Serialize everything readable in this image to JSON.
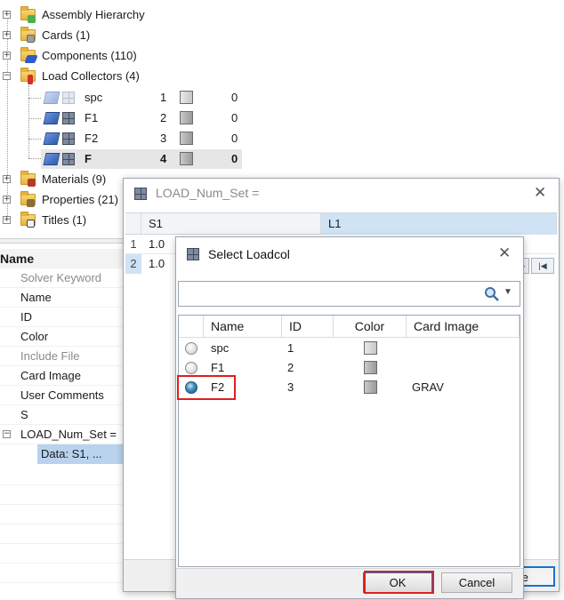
{
  "tree": {
    "nodes": [
      {
        "label": "Assembly Hierarchy",
        "expander": "+"
      },
      {
        "label": "Cards (1)",
        "expander": "+"
      },
      {
        "label": "Components (110)",
        "expander": "+"
      },
      {
        "label": "Load Collectors (4)",
        "expander": "−"
      },
      {
        "label": "Materials (9)",
        "expander": "+"
      },
      {
        "label": "Properties (21)",
        "expander": "+"
      },
      {
        "label": "Titles (1)",
        "expander": "+"
      }
    ],
    "load_collectors": [
      {
        "name": "spc",
        "id": "1",
        "value": "0"
      },
      {
        "name": "F1",
        "id": "2",
        "value": "0"
      },
      {
        "name": "F2",
        "id": "3",
        "value": "0"
      },
      {
        "name": "F",
        "id": "4",
        "value": "0"
      }
    ]
  },
  "properties": {
    "header": "Name",
    "rows": [
      {
        "label": "Solver Keyword",
        "disabled": true
      },
      {
        "label": "Name"
      },
      {
        "label": "ID"
      },
      {
        "label": "Color"
      },
      {
        "label": "Include File",
        "disabled": true
      },
      {
        "label": "Card Image"
      },
      {
        "label": "User Comments"
      },
      {
        "label": "S"
      },
      {
        "label": "LOAD_Num_Set ="
      }
    ],
    "subvalue": "Data: S1, ..."
  },
  "load_dialog": {
    "title": "LOAD_Num_Set =",
    "columns": [
      "S1",
      "L1"
    ],
    "rows": [
      {
        "index": "1",
        "s1": "1.0"
      },
      {
        "index": "2",
        "s1": "1.0"
      }
    ],
    "close_partial": "e"
  },
  "select_dialog": {
    "title": "Select Loadcol",
    "search_value": "",
    "columns": [
      "Name",
      "ID",
      "Color",
      "Card Image"
    ],
    "rows": [
      {
        "name": "spc",
        "id": "1",
        "card_image": "",
        "selected": false
      },
      {
        "name": "F1",
        "id": "2",
        "card_image": "",
        "selected": false
      },
      {
        "name": "F2",
        "id": "3",
        "card_image": "GRAV",
        "selected": true
      }
    ],
    "ok_label": "OK",
    "cancel_label": "Cancel"
  },
  "colors": {
    "selection_bg": "#e6e6e6",
    "subvalue_bg": "#b9d3ee",
    "header_accent": "#cfe3f5",
    "highlight_red": "#e01e1e"
  }
}
